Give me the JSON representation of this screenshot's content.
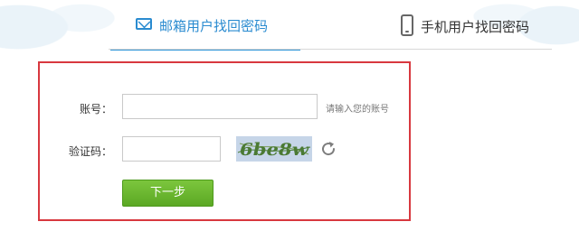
{
  "tabs": [
    {
      "label": "邮箱用户找回密码",
      "icon": "mail-icon",
      "active": true
    },
    {
      "label": "手机用户找回密码",
      "icon": "phone-icon",
      "active": false
    }
  ],
  "form": {
    "account_label": "账号：",
    "account_placeholder": "",
    "account_hint": "请输入您的账号",
    "code_label": "验证码：",
    "code_value": "",
    "captcha_text": "6be8w",
    "next_button": "下一步"
  },
  "colors": {
    "active_tab": "#2a8bd0",
    "highlight_border": "#d8383f",
    "button_green": "#6ab82f"
  }
}
